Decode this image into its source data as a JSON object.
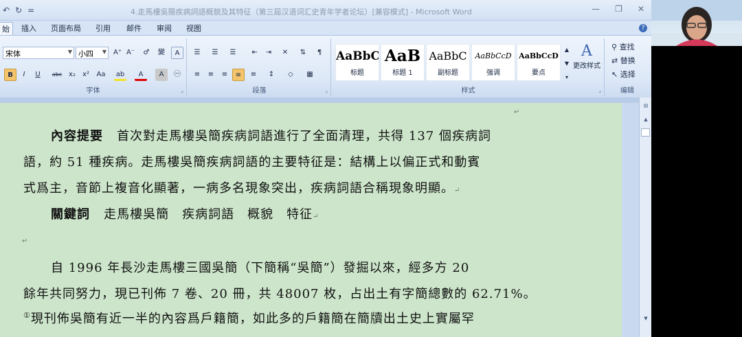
{
  "window": {
    "title": "4.走馬樓吳簡疾病詞語概貌及其特征（第三屆汉语词汇史青年学者论坛）[兼容模式] - Microsoft Word",
    "quick_access": [
      "↶",
      "↻",
      "="
    ],
    "controls": [
      "—",
      "❐",
      "✕"
    ]
  },
  "tabs": [
    "始",
    "插入",
    "页面布局",
    "引用",
    "邮件",
    "审阅",
    "视图"
  ],
  "ribbon": {
    "font": {
      "label": "字体",
      "name": "宋体",
      "size": "小四",
      "buttons_row1": [
        "A⁺",
        "A⁻",
        "♂",
        "變",
        "A"
      ],
      "buttons_row2": [
        "B",
        "I",
        "U",
        "abc",
        "x₂",
        "x²",
        "Aa",
        "ab",
        "A",
        "A",
        "㊀"
      ]
    },
    "paragraph": {
      "label": "段落",
      "buttons_row1": [
        "☰",
        "☰",
        "☰",
        "⇤",
        "⇥",
        "✕",
        "⇅",
        "¶"
      ],
      "buttons_row2": [
        "≡",
        "≡",
        "≡",
        "≡",
        "≡",
        "↕",
        "◇",
        "▦"
      ]
    },
    "styles": {
      "label": "样式",
      "items": [
        {
          "preview": "AaBbC",
          "name": "标题"
        },
        {
          "preview": "AaB",
          "name": "标题 1"
        },
        {
          "preview": "AaBbC",
          "name": "副标题"
        },
        {
          "preview": "AaBbCcD",
          "name": "强调"
        },
        {
          "preview": "AaBbCcD",
          "name": "要点"
        }
      ],
      "change_label": "更改样式"
    },
    "editing": {
      "label": "编辑",
      "items": [
        "查找",
        "替换",
        "选择"
      ]
    }
  },
  "document": {
    "abstract_label": "內容提要",
    "abstract_line1": "首次對走馬樓吳簡疾病詞語進行了全面清理，共得 137 個疾病詞",
    "abstract_line2": "語，約 51 種疾病。走馬樓吳簡疾病詞語的主要特征是：結構上以偏正式和動賓",
    "abstract_line3": "式爲主，音節上複音化顯著，一病多名現象突出，疾病詞語合稱現象明顯。",
    "keywords_label": "關鍵詞",
    "keywords": "走馬樓吳簡　疾病詞語　概貌　特征",
    "body_line1": "自 1996 年長沙走馬樓三國吳簡（下簡稱“吳簡”）發掘以來，經多方 20",
    "body_line2": "餘年共同努力，現已刊佈 7 卷、20 冊，共 48007 枚，占出土有字簡總數的 62.71%。",
    "body_line3_sup": "①",
    "body_line3": "現刊佈吳簡有近一半的內容爲戶籍簡，如此多的戶籍簡在簡牘出土史上實屬罕",
    "para_mark": "↵"
  },
  "colors": {
    "doc_background": "#cde6cb",
    "ribbon": "#dde8f7",
    "accent": "#f4c46b"
  }
}
